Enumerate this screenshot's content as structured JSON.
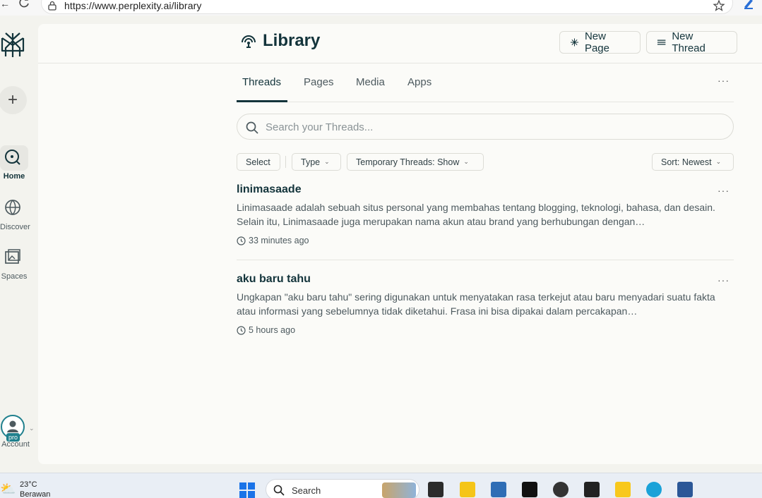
{
  "browser": {
    "url": "https://www.perplexity.ai/library"
  },
  "rail": {
    "new_label": "+",
    "items": [
      {
        "label": "Home",
        "icon": "home-icon"
      },
      {
        "label": "Discover",
        "icon": "globe-icon"
      },
      {
        "label": "Spaces",
        "icon": "spaces-icon"
      }
    ],
    "account": {
      "label": "Account",
      "badge": "pro"
    }
  },
  "header": {
    "title": "Library",
    "new_page_label": "New Page",
    "new_thread_label": "New Thread"
  },
  "tabs": [
    {
      "label": "Threads",
      "active": true
    },
    {
      "label": "Pages",
      "active": false
    },
    {
      "label": "Media",
      "active": false
    },
    {
      "label": "Apps",
      "active": false
    }
  ],
  "search": {
    "placeholder": "Search your Threads..."
  },
  "filters": {
    "select_label": "Select",
    "type_label": "Type",
    "temporary_label": "Temporary Threads: Show",
    "sort_label": "Sort: Newest"
  },
  "threads": [
    {
      "title": "linimasaade",
      "snippet": "Linimasaade adalah sebuah situs personal yang membahas tentang blogging, teknologi, bahasa, dan desain. Selain itu, Linimasaade juga merupakan nama akun atau brand yang berhubungan dengan…",
      "time": "33 minutes ago"
    },
    {
      "title": "aku baru tahu",
      "snippet": "Ungkapan \"aku baru tahu\" sering digunakan untuk menyatakan rasa terkejut atau baru menyadari suatu fakta atau informasi yang sebelumnya tidak diketahui. Frasa ini bisa dipakai dalam percakapan…",
      "time": "5 hours ago"
    }
  ],
  "more_label": "···",
  "taskbar": {
    "weather_temp": "23°C",
    "weather_cond": "Berawan",
    "search_label": "Search"
  },
  "colors": {
    "accent": "#20808d",
    "text": "#13343b",
    "background": "#fbfbf8"
  }
}
